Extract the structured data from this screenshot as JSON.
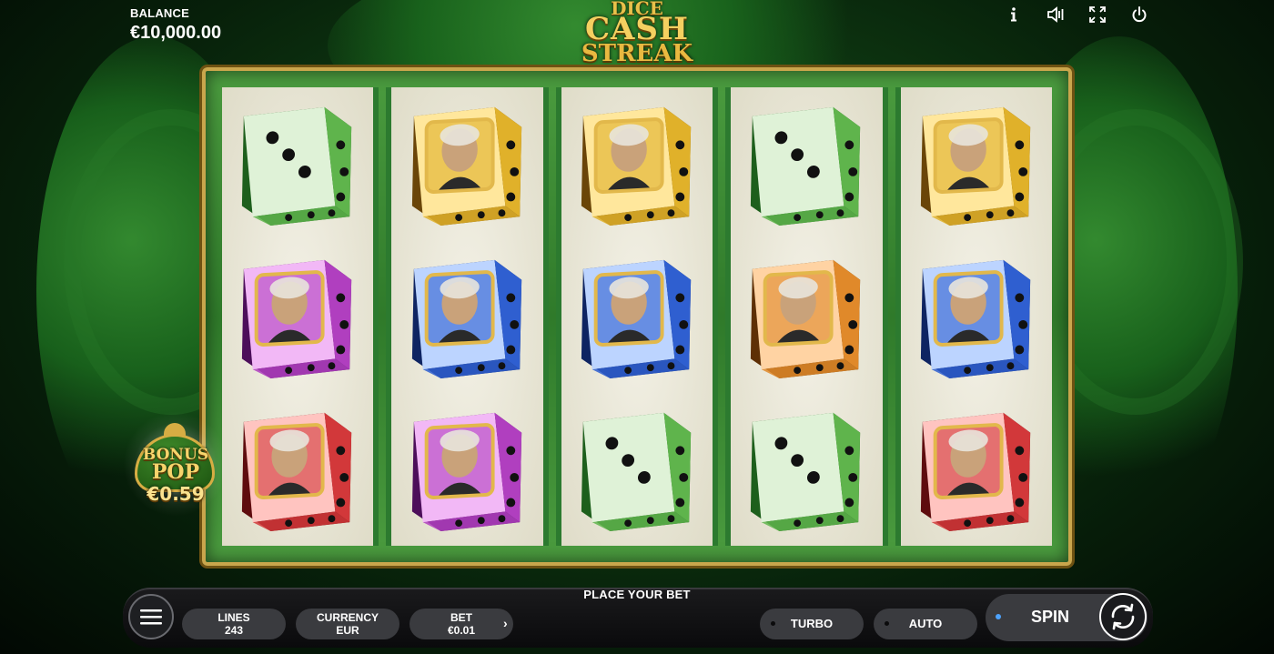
{
  "balance": {
    "label": "BALANCE",
    "value": "€10,000.00"
  },
  "logo": {
    "line1": "DICE",
    "line2": "CASH",
    "line3": "STREAK"
  },
  "top_icons": [
    "info-icon",
    "sound-icon",
    "fullscreen-icon",
    "power-icon"
  ],
  "reels": [
    [
      "green-dice-3",
      "purple-dice-franklin",
      "red-dice-washington"
    ],
    [
      "gold-dice-jackson",
      "blue-dice-lincoln",
      "purple-dice-franklin"
    ],
    [
      "gold-dice-jackson",
      "blue-dice-lincoln",
      "green-dice-3"
    ],
    [
      "green-dice-3",
      "orange-dice-grant",
      "green-dice-3"
    ],
    [
      "gold-dice-jackson",
      "blue-dice-lincoln",
      "red-dice-washington"
    ]
  ],
  "colors": {
    "green": "#3f9a3a",
    "purple": "#b03fbf",
    "red": "#d2383a",
    "gold": "#e0b12a",
    "blue": "#2f5fd0",
    "orange": "#e0892a",
    "accent_blue": "#4da3ff"
  },
  "bonus": {
    "line1": "BONUS",
    "line2": "POP",
    "amount": "€0.59"
  },
  "footer": {
    "status": "PLACE YOUR BET",
    "lines": {
      "label": "LINES",
      "value": "243"
    },
    "currency": {
      "label": "CURRENCY",
      "value": "EUR"
    },
    "bet": {
      "label": "BET",
      "value": "€0.01"
    },
    "turbo_label": "TURBO",
    "auto_label": "AUTO",
    "spin_label": "SPIN"
  }
}
